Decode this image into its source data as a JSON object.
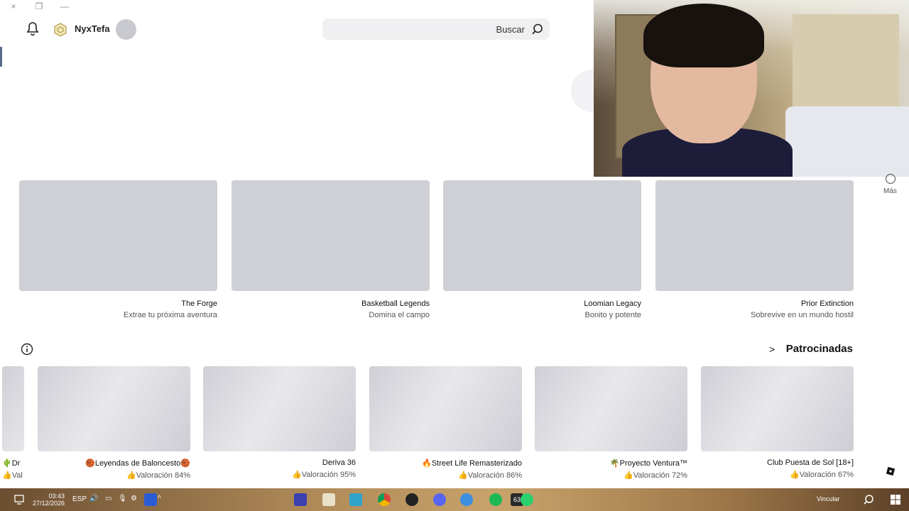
{
  "window_controls": [
    "×",
    "❐",
    "—"
  ],
  "header": {
    "username": "NyxTefa",
    "search_placeholder": "Buscar"
  },
  "side": {
    "more_label": "Más"
  },
  "games": [
    {
      "title": "The Forge",
      "subtitle": "Extrae tu próxima aventura"
    },
    {
      "title": "Basketball Legends",
      "subtitle": "Domina el campo"
    },
    {
      "title": "Loomian Legacy",
      "subtitle": "Bonito y potente"
    },
    {
      "title": "Prior Extinction",
      "subtitle": "Sobrevive en un mundo hostil"
    }
  ],
  "sponsored": {
    "heading": "Patrocinadas",
    "edge_title": "🌵Dr",
    "edge_rating": "👍Val",
    "items": [
      {
        "title": "🏀Leyendas de Baloncesto🏀",
        "rating": "👍Valoración 84%"
      },
      {
        "title": "Deriva 36",
        "rating": "👍Valoración 95%"
      },
      {
        "title": "🔥Street Life Remasterizado",
        "rating": "👍Valoración 86%"
      },
      {
        "title": "🌴Proyecto Ventura™",
        "rating": "👍Valoración 72%"
      },
      {
        "title": "Club Puesta de Sol [18+]",
        "rating": "👍Valoración 67%"
      }
    ]
  },
  "taskbar": {
    "time": "03:43",
    "date": "27/12/2026",
    "lang": "ESP",
    "badge": "63",
    "search_text": "Vincular"
  },
  "colors": {
    "thumb": "#cfcfd6",
    "header_bg": "#ffffff",
    "search_bg": "#f0f0f2"
  }
}
